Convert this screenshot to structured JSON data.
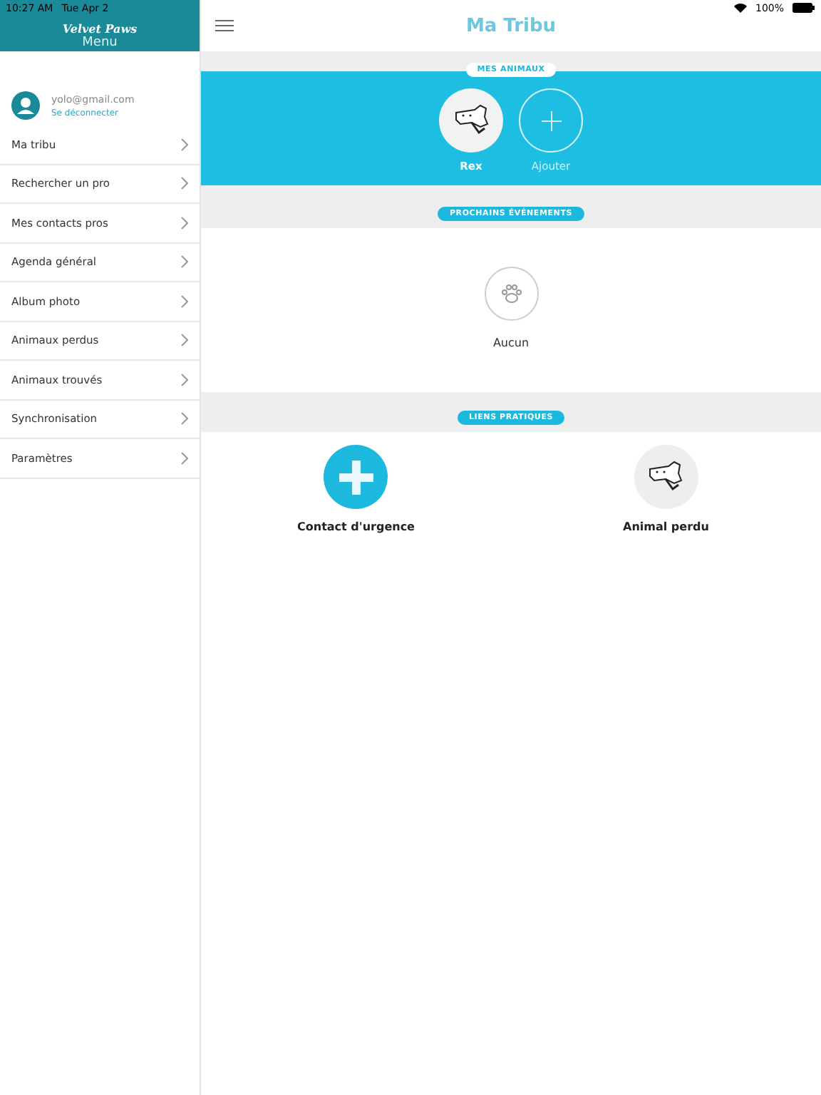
{
  "status_bar": {
    "time": "10:27 AM",
    "date": "Tue Apr 2",
    "battery": "100%"
  },
  "sidebar": {
    "logo": "Velvet Paws",
    "title": "Menu",
    "account": {
      "email": "yolo@gmail.com",
      "logout": "Se déconnecter"
    },
    "items": [
      "Ma tribu",
      "Rechercher un pro",
      "Mes contacts pros",
      "Agenda général",
      "Album photo",
      "Animaux perdus",
      "Animaux trouvés",
      "Synchronisation",
      "Paramètres"
    ]
  },
  "header": {
    "title": "Ma Tribu"
  },
  "animals": {
    "label": "MES ANIMAUX",
    "items": [
      {
        "kind": "pet",
        "name": "Rex"
      },
      {
        "kind": "add",
        "name": "Ajouter"
      }
    ]
  },
  "events": {
    "label": "PROCHAINS ÉVÉNEMENTS",
    "empty": "Aucun"
  },
  "links": {
    "label": "LIENS PRATIQUES",
    "items": [
      {
        "kind": "emergency",
        "name": "Contact d'urgence"
      },
      {
        "kind": "lost",
        "name": "Animal perdu"
      }
    ]
  }
}
